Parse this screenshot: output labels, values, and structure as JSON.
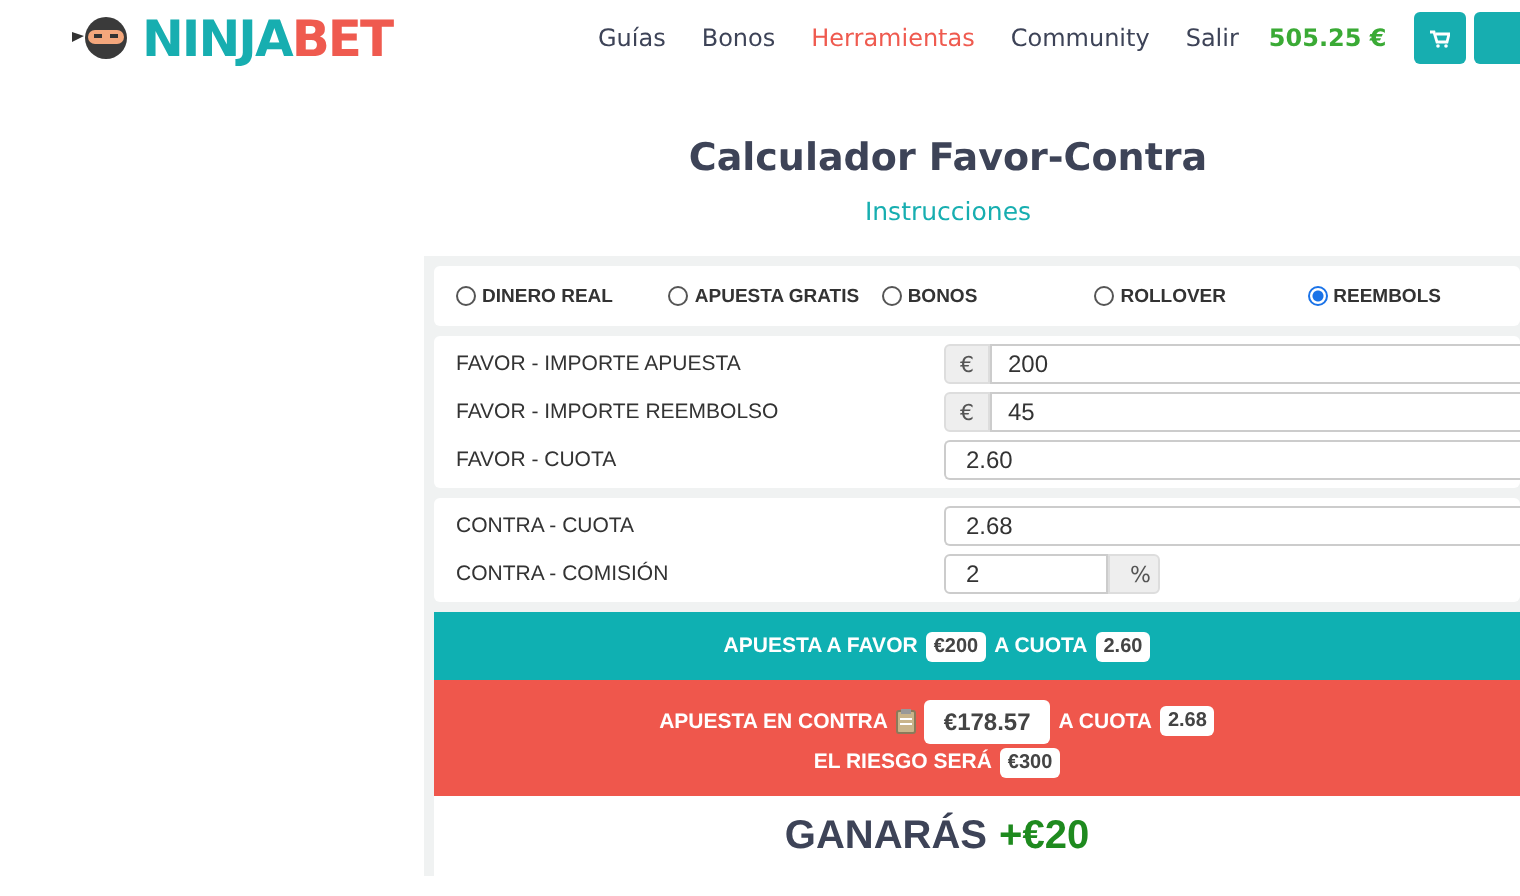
{
  "header": {
    "logo": {
      "part_1": "NINJA",
      "part_2": "BET"
    },
    "nav": [
      {
        "label": "Guías",
        "selected": false
      },
      {
        "label": "Bonos",
        "selected": false
      },
      {
        "label": "Herramientas",
        "selected": true
      },
      {
        "label": "Community",
        "selected": false
      },
      {
        "label": "Salir",
        "selected": false
      }
    ],
    "balance": "505.25 €"
  },
  "title": "Calculador Favor-Contra",
  "instructions_link": "Instrucciones",
  "modes": [
    {
      "label": "DINERO REAL",
      "selected": false
    },
    {
      "label": "APUESTA GRATIS",
      "selected": false
    },
    {
      "label": "BONOS",
      "selected": false
    },
    {
      "label": "ROLLOVER",
      "selected": false
    },
    {
      "label": "REEMBOLS",
      "selected": true
    }
  ],
  "favor_fields": [
    {
      "label": "FAVOR - IMPORTE APUESTA",
      "prefix": "€",
      "value": "200"
    },
    {
      "label": "FAVOR - IMPORTE REEMBOLSO",
      "prefix": "€",
      "value": "45"
    },
    {
      "label": "FAVOR - CUOTA",
      "value": "2.60"
    }
  ],
  "contra_fields": [
    {
      "label": "CONTRA - CUOTA",
      "value": "2.68"
    },
    {
      "label": "CONTRA - COMISIÓN",
      "value": "2",
      "suffix": "%"
    }
  ],
  "favor_result": {
    "label": "APUESTA A FAVOR",
    "stake": "€200",
    "odds_label": "A CUOTA",
    "odds": "2.60"
  },
  "contra_result": {
    "label": "APUESTA EN CONTRA",
    "stake": "€178.57",
    "odds_label": "A CUOTA",
    "odds": "2.68",
    "risk_label": "EL RIESGO SERÁ",
    "risk": "€300"
  },
  "outcome": {
    "label": "GANARÁS",
    "amount": "+€20"
  }
}
